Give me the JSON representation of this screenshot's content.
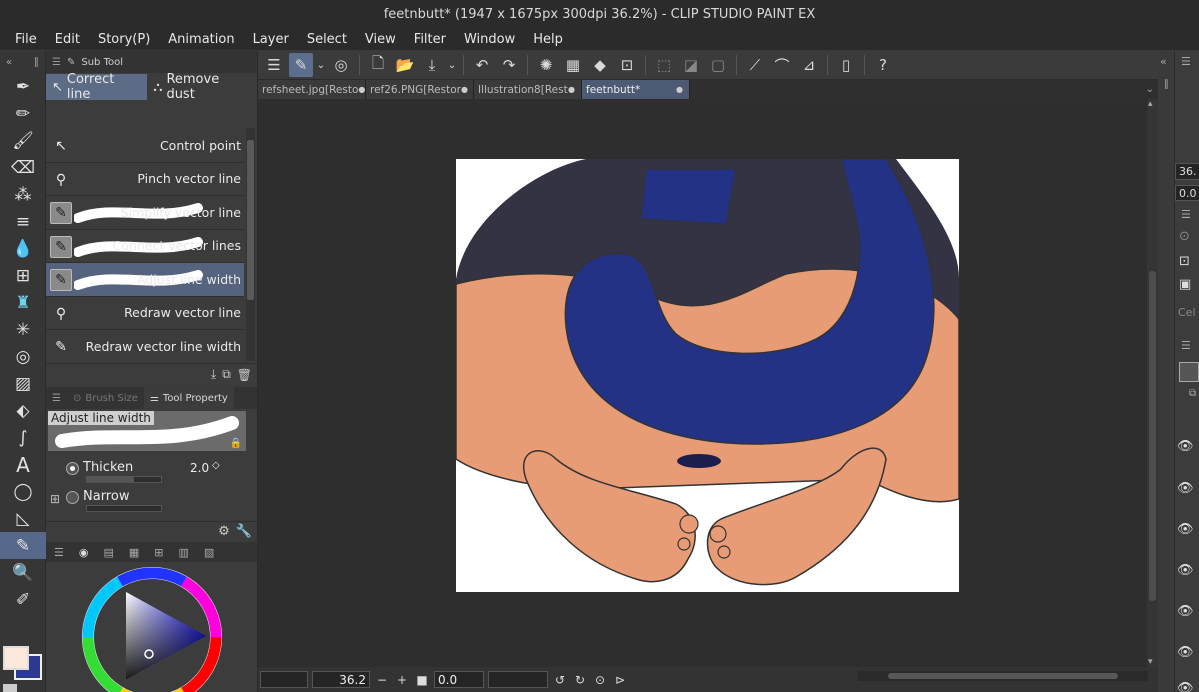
{
  "window": {
    "title": "feetnbutt* (1947 x 1675px 300dpi 36.2%)  - CLIP STUDIO PAINT EX"
  },
  "menu": [
    "File",
    "Edit",
    "Story(P)",
    "Animation",
    "Layer",
    "Select",
    "View",
    "Filter",
    "Window",
    "Help"
  ],
  "sub_tool": {
    "panel_title": "Sub Tool",
    "tabs": [
      "Correct line",
      "Remove dust"
    ],
    "items": [
      {
        "label": "Control point",
        "icon": "control-point-icon"
      },
      {
        "label": "Pinch vector line",
        "icon": "pinch-icon"
      },
      {
        "label": "Simplify vector line",
        "icon": "simplify-icon"
      },
      {
        "label": "Connect vector lines",
        "icon": "connect-icon"
      },
      {
        "label": "Adjust line width",
        "icon": "adjust-width-icon"
      },
      {
        "label": "Redraw vector line",
        "icon": "redraw-icon"
      },
      {
        "label": "Redraw vector line width",
        "icon": "redraw-width-icon"
      }
    ],
    "selected_index": 4
  },
  "tool_property": {
    "tabs": [
      "Brush Size",
      "Tool Property"
    ],
    "preview_label": "Adjust line width",
    "options": [
      {
        "label": "Thicken",
        "value": "2.0",
        "checked": true
      },
      {
        "label": "Narrow",
        "value": "",
        "checked": false
      }
    ]
  },
  "documents": {
    "tabs": [
      {
        "label": "refsheet.jpg[Resto",
        "active": false
      },
      {
        "label": "ref26.PNG[Restor",
        "active": false
      },
      {
        "label": "Illustration8[Rest",
        "active": false
      },
      {
        "label": "feetnbutt*",
        "active": true
      }
    ]
  },
  "status": {
    "zoom": "36.2",
    "rotation": "0.0"
  },
  "right_panel": {
    "zoom_value": "36.",
    "rotation_value": "0.0",
    "label_cel": "Cel"
  },
  "colors": {
    "main_color": "#fde9dc",
    "sub_color": "#2b3a8f",
    "accent": "#56698a"
  }
}
